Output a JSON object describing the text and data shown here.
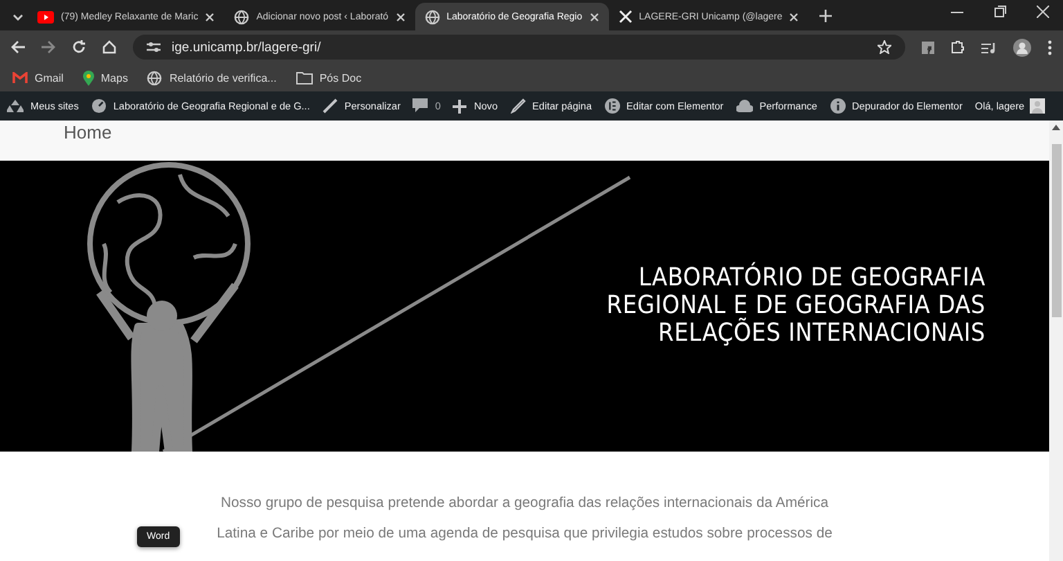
{
  "tabs": [
    {
      "title": "(79) Medley Relaxante de Maric",
      "kind": "video",
      "selected": false
    },
    {
      "title": "Adicionar novo post ‹ Laborató",
      "kind": "globe",
      "selected": false
    },
    {
      "title": "Laboratório de Geografia Regio",
      "kind": "globe",
      "selected": true
    },
    {
      "title": "LAGERE-GRI Unicamp (@lagere",
      "kind": "x",
      "selected": false
    }
  ],
  "address": "ige.unicamp.br/lagere-gri/",
  "bookmarks": [
    {
      "label": "Gmail",
      "kind": "mail"
    },
    {
      "label": "Maps",
      "kind": "pin"
    },
    {
      "label": "Relatório de verifica...",
      "kind": "globe"
    },
    {
      "label": "Pós Doc",
      "kind": "folder"
    }
  ],
  "admin_bar": {
    "items": [
      {
        "label": "Meus sites",
        "kind": "sites"
      },
      {
        "label": "Laboratório de Geografia Regional e de G...",
        "kind": "dashboard"
      },
      {
        "label": "Personalizar",
        "kind": "brush"
      },
      {
        "label": "0",
        "kind": "comment"
      },
      {
        "label": "Novo",
        "kind": "plus"
      },
      {
        "label": "Editar página",
        "kind": "pencil"
      },
      {
        "label": "Editar com Elementor",
        "kind": "elementor"
      },
      {
        "label": "Performance",
        "kind": "cloud"
      },
      {
        "label": "Depurador do Elementor",
        "kind": "info"
      }
    ],
    "greeting": "Olá, lagere"
  },
  "page": {
    "nav_title": "Home",
    "hero_title": "LABORATÓRIO DE GEOGRAFIA\nREGIONAL E DE GEOGRAFIA DAS\nRELAÇÕES INTERNACIONAIS",
    "paragraph": "Nosso grupo de pesquisa pretende abordar a geografia das relações internacionais da América Latina e Caribe por meio de uma agenda de pesquisa que privilegia estudos sobre processos de",
    "tooltip": "Word"
  }
}
